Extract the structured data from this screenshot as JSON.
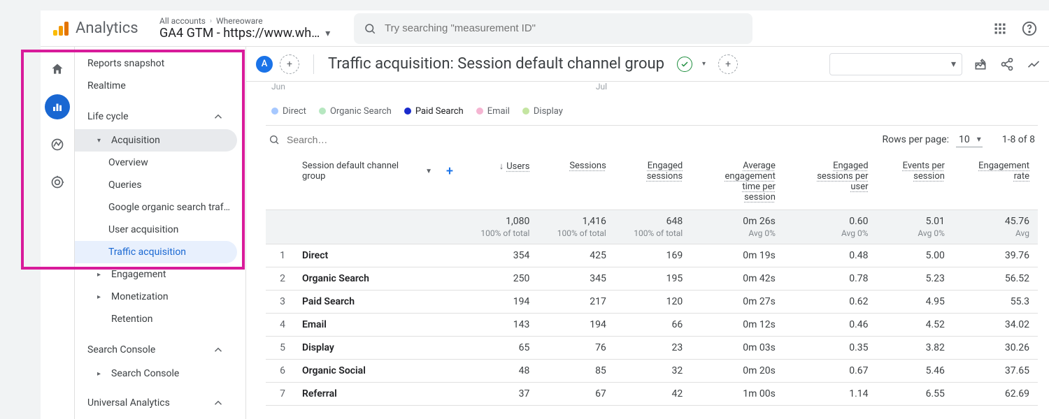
{
  "header": {
    "brand": "Analytics",
    "breadcrumb": {
      "root": "All accounts",
      "child": "Whereoware"
    },
    "property": "GA4 GTM - https://www.wh…",
    "search_placeholder": "Try searching \"measurement ID\""
  },
  "nav": {
    "reports_snapshot": "Reports snapshot",
    "realtime": "Realtime",
    "life_cycle": "Life cycle",
    "acquisition": "Acquisition",
    "acq_items": {
      "overview": "Overview",
      "queries": "Queries",
      "google_organic": "Google organic search traf…",
      "user_acq": "User acquisition",
      "traffic_acq": "Traffic acquisition"
    },
    "engagement": "Engagement",
    "monetization": "Monetization",
    "retention": "Retention",
    "search_console_group": "Search Console",
    "search_console_item": "Search Console",
    "universal_analytics": "Universal Analytics"
  },
  "main": {
    "avatar_letter": "A",
    "title": "Traffic acquisition: Session default channel group",
    "axis": {
      "left": "Jun",
      "right": "Jul"
    },
    "legend": {
      "direct": "Direct",
      "organic_search": "Organic Search",
      "paid_search": "Paid Search",
      "email": "Email",
      "display": "Display"
    },
    "legend_colors": {
      "direct": "#a6c8ff",
      "organic_search": "#b6e7c0",
      "paid_search": "#1a2bcc",
      "email": "#f5b5d2",
      "display": "#c4e5a1"
    },
    "table": {
      "search_placeholder": "Search…",
      "rows_per_page_label": "Rows per page:",
      "rows_per_page_value": "10",
      "range": "1-8 of 8",
      "dimension_label": "Session default channel group",
      "columns": {
        "users": "Users",
        "sessions": "Sessions",
        "engaged_sessions": "Engaged sessions",
        "avg_eng_time": "Average engagement time per session",
        "eng_sessions_per_user": "Engaged sessions per user",
        "events_per_session": "Events per session",
        "engagement_rate": "Engagement rate"
      },
      "totals": {
        "users": "1,080",
        "users_sub": "100% of total",
        "sessions": "1,416",
        "sessions_sub": "100% of total",
        "engaged_sessions": "648",
        "engaged_sessions_sub": "100% of total",
        "avg_eng_time": "0m 26s",
        "avg_eng_time_sub": "Avg 0%",
        "eng_sessions_per_user": "0.60",
        "eng_sessions_per_user_sub": "Avg 0%",
        "events_per_session": "5.01",
        "events_per_session_sub": "Avg 0%",
        "engagement_rate": "45.76",
        "engagement_rate_sub": "Avg"
      },
      "rows": [
        {
          "idx": "1",
          "dim": "Direct",
          "users": "354",
          "sessions": "425",
          "engaged_sessions": "169",
          "avg_eng_time": "0m 19s",
          "eng_per_user": "0.48",
          "events_per_session": "5.00",
          "eng_rate": "39.76"
        },
        {
          "idx": "2",
          "dim": "Organic Search",
          "users": "250",
          "sessions": "345",
          "engaged_sessions": "195",
          "avg_eng_time": "0m 42s",
          "eng_per_user": "0.78",
          "events_per_session": "5.23",
          "eng_rate": "56.52"
        },
        {
          "idx": "3",
          "dim": "Paid Search",
          "users": "194",
          "sessions": "217",
          "engaged_sessions": "120",
          "avg_eng_time": "0m 27s",
          "eng_per_user": "0.62",
          "events_per_session": "4.95",
          "eng_rate": "55.3"
        },
        {
          "idx": "4",
          "dim": "Email",
          "users": "143",
          "sessions": "194",
          "engaged_sessions": "66",
          "avg_eng_time": "0m 12s",
          "eng_per_user": "0.46",
          "events_per_session": "4.52",
          "eng_rate": "34.02"
        },
        {
          "idx": "5",
          "dim": "Display",
          "users": "65",
          "sessions": "76",
          "engaged_sessions": "23",
          "avg_eng_time": "0m 03s",
          "eng_per_user": "0.35",
          "events_per_session": "3.82",
          "eng_rate": "30.26"
        },
        {
          "idx": "6",
          "dim": "Organic Social",
          "users": "48",
          "sessions": "85",
          "engaged_sessions": "32",
          "avg_eng_time": "0m 20s",
          "eng_per_user": "0.67",
          "events_per_session": "5.46",
          "eng_rate": "37.65"
        },
        {
          "idx": "7",
          "dim": "Referral",
          "users": "37",
          "sessions": "67",
          "engaged_sessions": "42",
          "avg_eng_time": "1m 00s",
          "eng_per_user": "1.14",
          "events_per_session": "6.55",
          "eng_rate": "62.69"
        }
      ]
    }
  }
}
